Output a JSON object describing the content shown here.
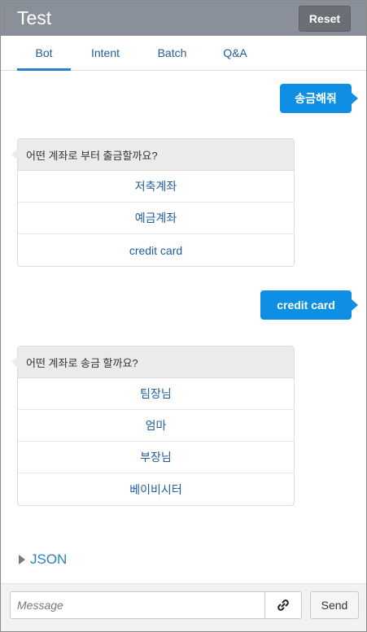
{
  "header": {
    "title": "Test",
    "reset_label": "Reset"
  },
  "tabs": [
    {
      "label": "Bot",
      "active": true
    },
    {
      "label": "Intent",
      "active": false
    },
    {
      "label": "Batch",
      "active": false
    },
    {
      "label": "Q&A",
      "active": false
    }
  ],
  "conversation": {
    "user_messages": [
      "송금해줘",
      "credit card"
    ],
    "bot_cards": [
      {
        "question": "어떤 계좌로 부터 출금할까요?",
        "options": [
          "저축계좌",
          "예금계좌",
          "credit card"
        ]
      },
      {
        "question": "어떤 계좌로 송금 할까요?",
        "options": [
          "팀장님",
          "엄마",
          "부장님",
          "베이비시터"
        ]
      }
    ]
  },
  "json_toggle": {
    "label": "JSON"
  },
  "composer": {
    "placeholder": "Message",
    "link_icon": "link-icon",
    "send_label": "Send"
  },
  "colors": {
    "header_bg": "#8a9099",
    "user_bubble": "#0e8fe3",
    "link_text": "#1f5e9b",
    "tab_indicator": "#2b7fc4"
  }
}
